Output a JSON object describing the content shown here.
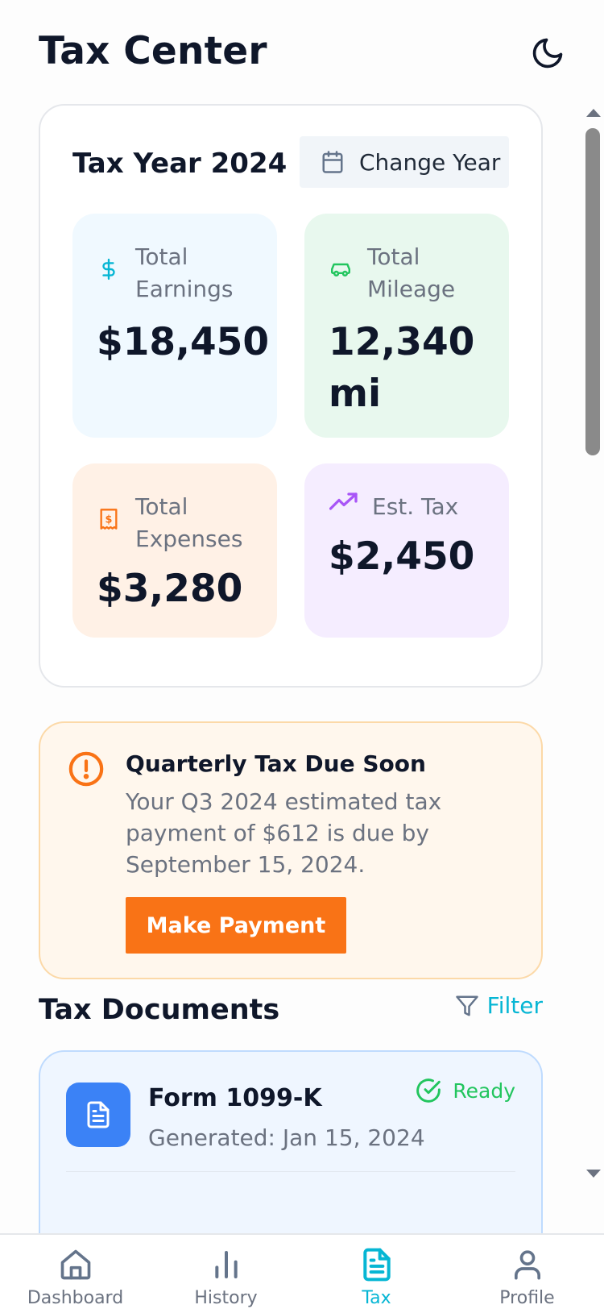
{
  "header": {
    "title": "Tax Center",
    "theme_icon": "moon-icon"
  },
  "summary": {
    "title": "Tax Year 2024",
    "change_year_label": "Change Year",
    "stats": [
      {
        "label": "Total Earnings",
        "value": "$18,450",
        "icon": "dollar-icon",
        "color": "#06b6d4"
      },
      {
        "label": "Total Mileage",
        "value": "12,340 mi",
        "icon": "car-icon",
        "color": "#22c55e"
      },
      {
        "label": "Total Expenses",
        "value": "$3,280",
        "icon": "receipt-icon",
        "color": "#f97316"
      },
      {
        "label": "Est. Tax",
        "value": "$2,450",
        "icon": "trending-up-icon",
        "color": "#a855f7"
      }
    ]
  },
  "alert": {
    "title": "Quarterly Tax Due Soon",
    "message": "Your Q3 2024 estimated tax payment of $612 is due by September 15, 2024.",
    "button_label": "Make Payment",
    "color": "#f97316"
  },
  "documents": {
    "title": "Tax Documents",
    "filter_label": "Filter",
    "items": [
      {
        "title": "Form 1099-K",
        "subtitle": "Generated: Jan 15, 2024",
        "status": "Ready",
        "status_color": "#22c55e"
      }
    ]
  },
  "nav": {
    "items": [
      {
        "label": "Dashboard",
        "icon": "home-icon",
        "active": false
      },
      {
        "label": "History",
        "icon": "bar-chart-icon",
        "active": false
      },
      {
        "label": "Tax",
        "icon": "document-icon",
        "active": true
      },
      {
        "label": "Profile",
        "icon": "user-icon",
        "active": false
      }
    ],
    "accent": "#06b6d4"
  }
}
